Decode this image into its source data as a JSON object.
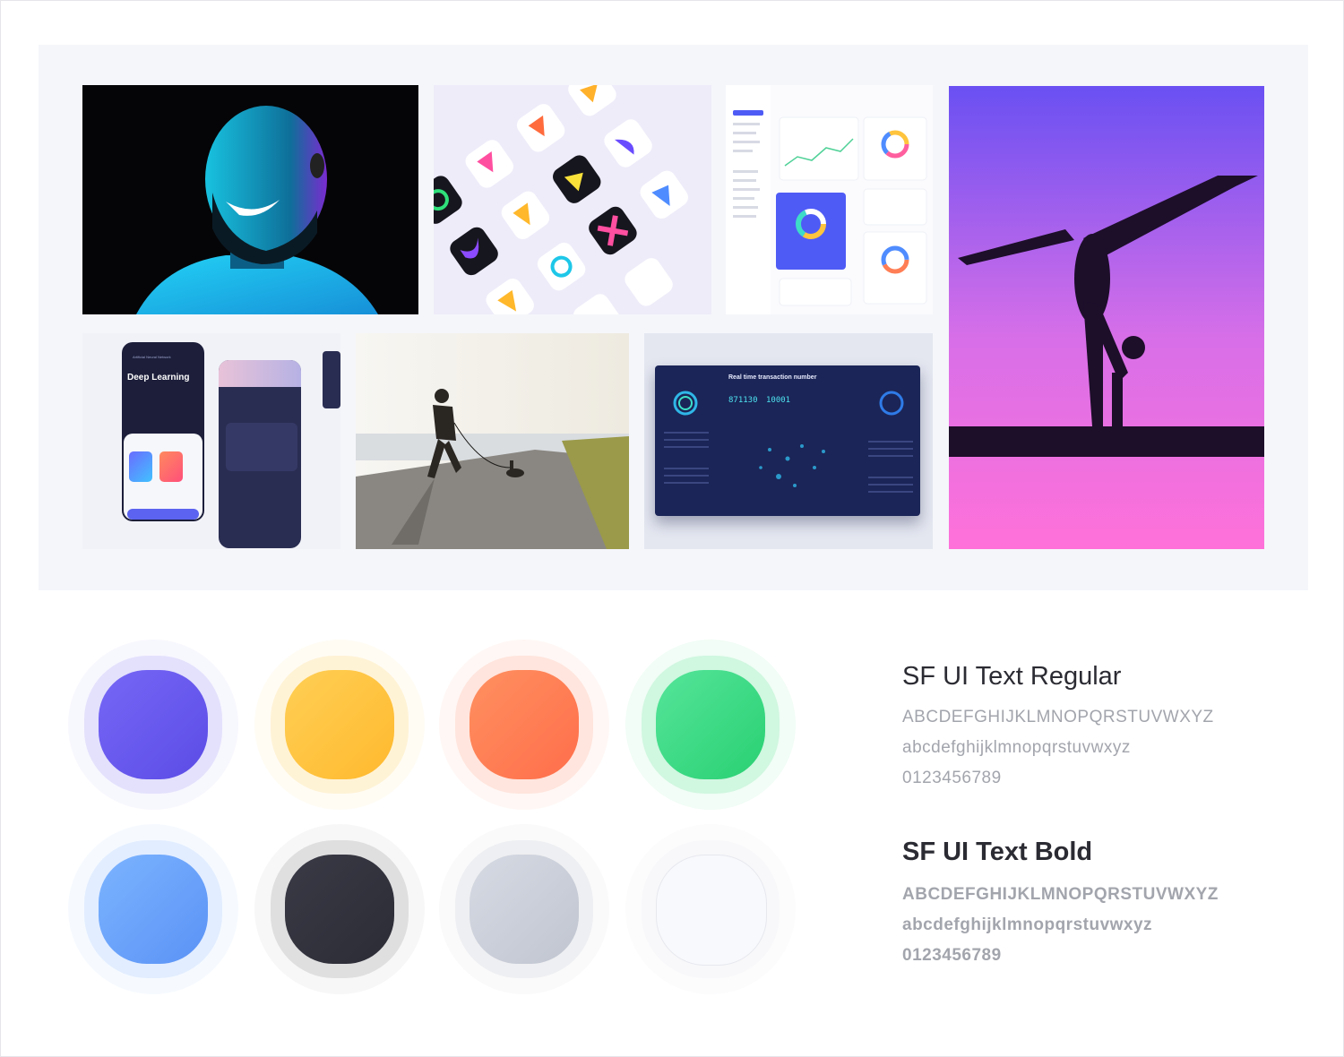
{
  "moodboard": {
    "tiles": [
      {
        "name": "portrait-tile",
        "icon": "portrait-photo"
      },
      {
        "name": "app-icons-tile",
        "icon": "app-icons-grid"
      },
      {
        "name": "dashboard-tile",
        "icon": "dashboard-screenshot"
      },
      {
        "name": "gymnast-tile",
        "icon": "gymnast-photo"
      },
      {
        "name": "mobile-app-tile",
        "icon": "mobile-app-screens"
      },
      {
        "name": "runner-tile",
        "icon": "runner-photo"
      },
      {
        "name": "analytics-tile",
        "icon": "analytics-dashboard"
      }
    ],
    "mobile_app": {
      "heading": "Deep Learning",
      "subtitle": "Artificial Neural Network"
    },
    "analytics": {
      "heading": "Real time transaction number",
      "value_left": "871130",
      "value_right": "10001"
    }
  },
  "palette": {
    "colors": [
      {
        "name": "purple",
        "hex": "#6b5cf0"
      },
      {
        "name": "yellow",
        "hex": "#ffc43d"
      },
      {
        "name": "orange",
        "hex": "#ff7e55"
      },
      {
        "name": "green",
        "hex": "#3ddc80"
      },
      {
        "name": "blue",
        "hex": "#6aa4fc"
      },
      {
        "name": "dark",
        "hex": "#32323c"
      },
      {
        "name": "gray",
        "hex": "#cdd1da"
      },
      {
        "name": "white",
        "hex": "#f8f9fc"
      }
    ]
  },
  "typography": {
    "regular": {
      "title": "SF UI Text Regular",
      "uppercase": "ABCDEFGHIJKLMNOPQRSTUVWXYZ",
      "lowercase": "abcdefghijklmnopqrstuvwxyz",
      "digits": "0123456789"
    },
    "bold": {
      "title": "SF UI Text Bold",
      "uppercase": "ABCDEFGHIJKLMNOPQRSTUVWXYZ",
      "lowercase": "abcdefghijklmnopqrstuvwxyz",
      "digits": "0123456789"
    }
  }
}
